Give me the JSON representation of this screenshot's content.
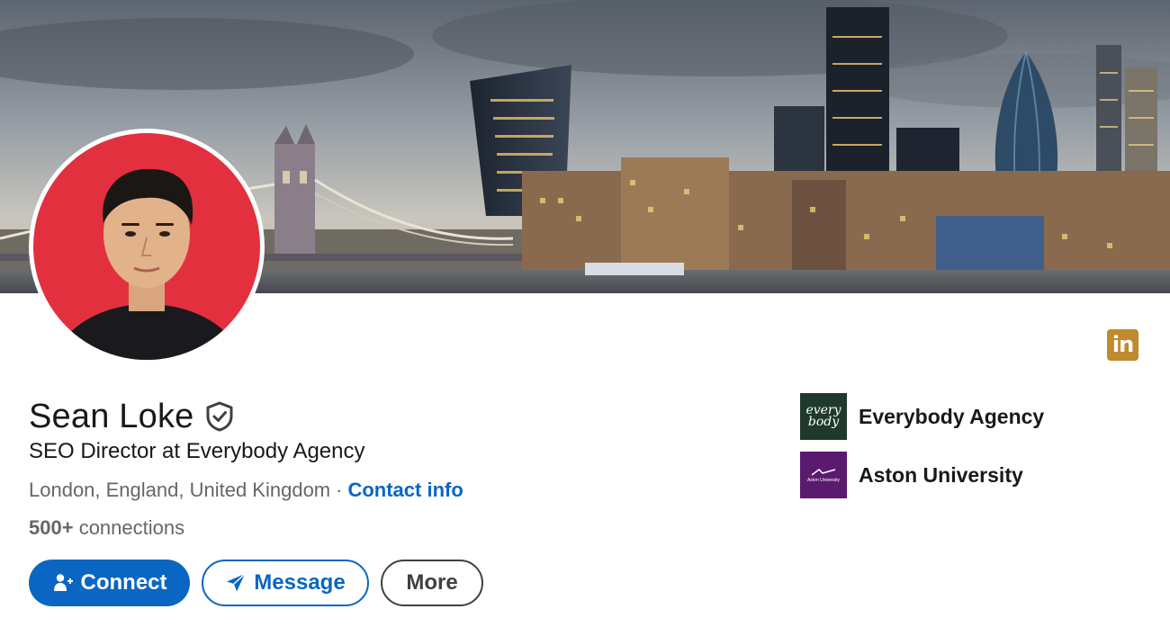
{
  "profile": {
    "name": "Sean Loke",
    "headline": "SEO Director at Everybody Agency",
    "location": "London, England, United Kingdom",
    "separator": "·",
    "contact_info_label": "Contact info",
    "connections_count": "500+",
    "connections_label": "connections"
  },
  "actions": {
    "connect_label": "Connect",
    "message_label": "Message",
    "more_label": "More"
  },
  "organizations": [
    {
      "name": "Everybody Agency",
      "logo_text_1": "every",
      "logo_text_2": "body",
      "icon": "everybody-agency-logo"
    },
    {
      "name": "Aston University",
      "logo_text": "Aston University",
      "icon": "aston-university-logo"
    }
  ],
  "badge": {
    "text": "in",
    "icon": "linkedin-icon"
  },
  "colors": {
    "primary": "#0a66c2",
    "linkedin_badge": "#c08a2e",
    "avatar_background": "#e3303f",
    "everybody_logo_bg": "#1f3a2c",
    "aston_logo_bg": "#5a1a6e"
  },
  "icons": {
    "verified": "shield-check-icon",
    "connect": "add-person-icon",
    "message": "paper-plane-icon"
  }
}
